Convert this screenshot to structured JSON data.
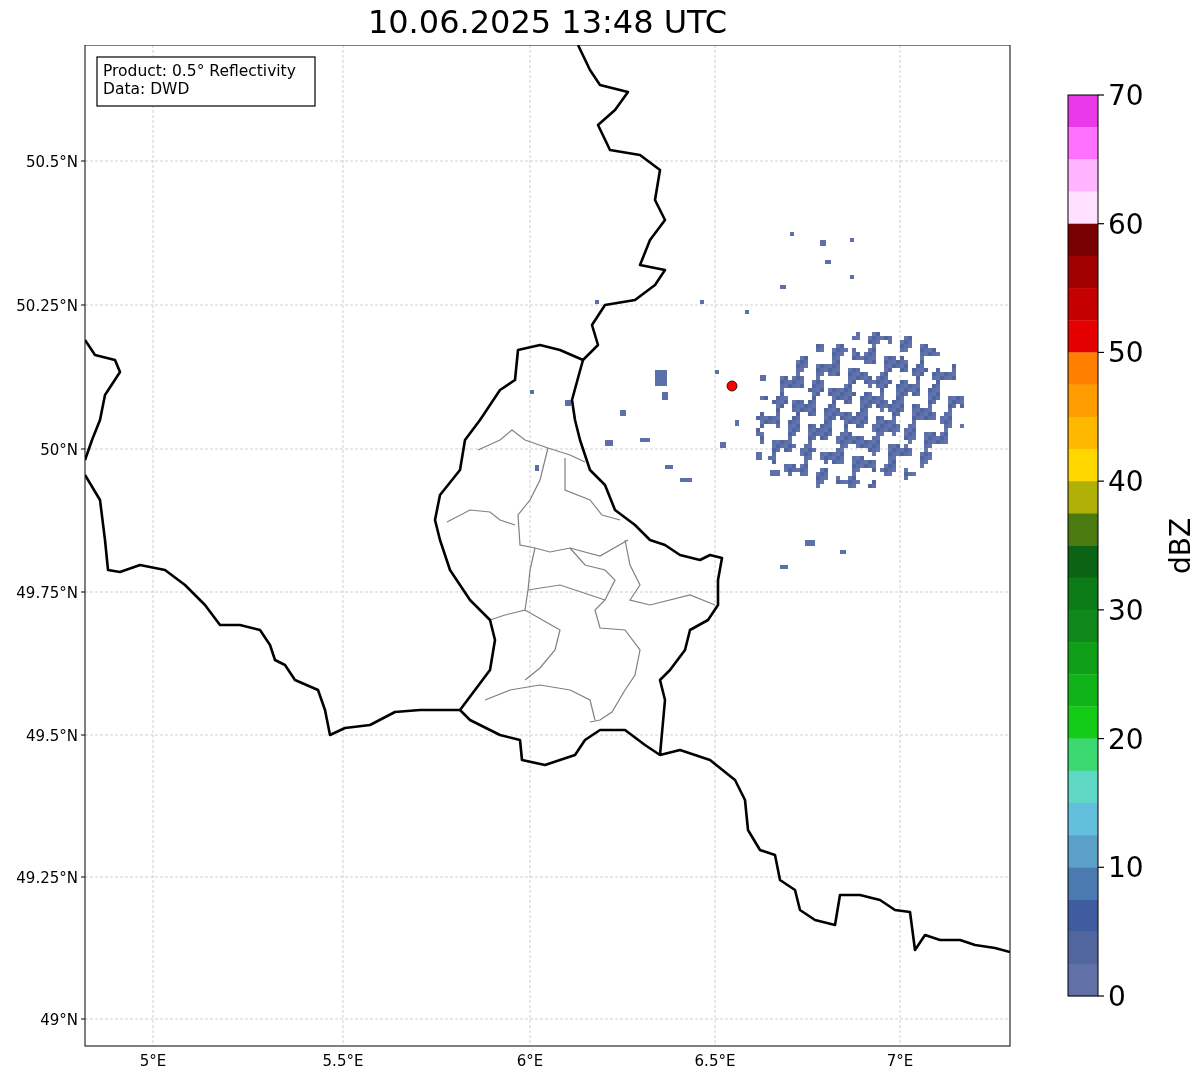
{
  "title": "10.06.2025 13:48 UTC",
  "info_box": [
    "Product: 0.5° Reflectivity",
    "Data: DWD"
  ],
  "lat_ticks": [
    "50.5°N",
    "50.25°N",
    "50°N",
    "49.75°N",
    "49.5°N",
    "49.25°N",
    "49°N"
  ],
  "lon_ticks": [
    "5°E",
    "5.5°E",
    "6°E",
    "6.5°E",
    "7°E"
  ],
  "colorbar": {
    "label": "dBZ",
    "ticks": [
      "70",
      "60",
      "50",
      "40",
      "30",
      "20",
      "10",
      "0"
    ],
    "segments": [
      {
        "color": "#e838e8"
      },
      {
        "color": "#ff70ff"
      },
      {
        "color": "#ffb4ff"
      },
      {
        "color": "#ffe0ff"
      },
      {
        "color": "#780000"
      },
      {
        "color": "#a00000"
      },
      {
        "color": "#c40000"
      },
      {
        "color": "#e40000"
      },
      {
        "color": "#ff8000"
      },
      {
        "color": "#ff9c00"
      },
      {
        "color": "#ffb800"
      },
      {
        "color": "#ffd800"
      },
      {
        "color": "#b0b008"
      },
      {
        "color": "#4a7a10"
      },
      {
        "color": "#0a6414"
      },
      {
        "color": "#0c7c18"
      },
      {
        "color": "#10881a"
      },
      {
        "color": "#10a018"
      },
      {
        "color": "#10b418"
      },
      {
        "color": "#12cc18"
      },
      {
        "color": "#3cd870"
      },
      {
        "color": "#5ed8c4"
      },
      {
        "color": "#62c0dc"
      },
      {
        "color": "#5ba0c8"
      },
      {
        "color": "#4a7ab0"
      },
      {
        "color": "#405ca0"
      },
      {
        "color": "#51669f"
      },
      {
        "color": "#6170a6"
      }
    ]
  }
}
